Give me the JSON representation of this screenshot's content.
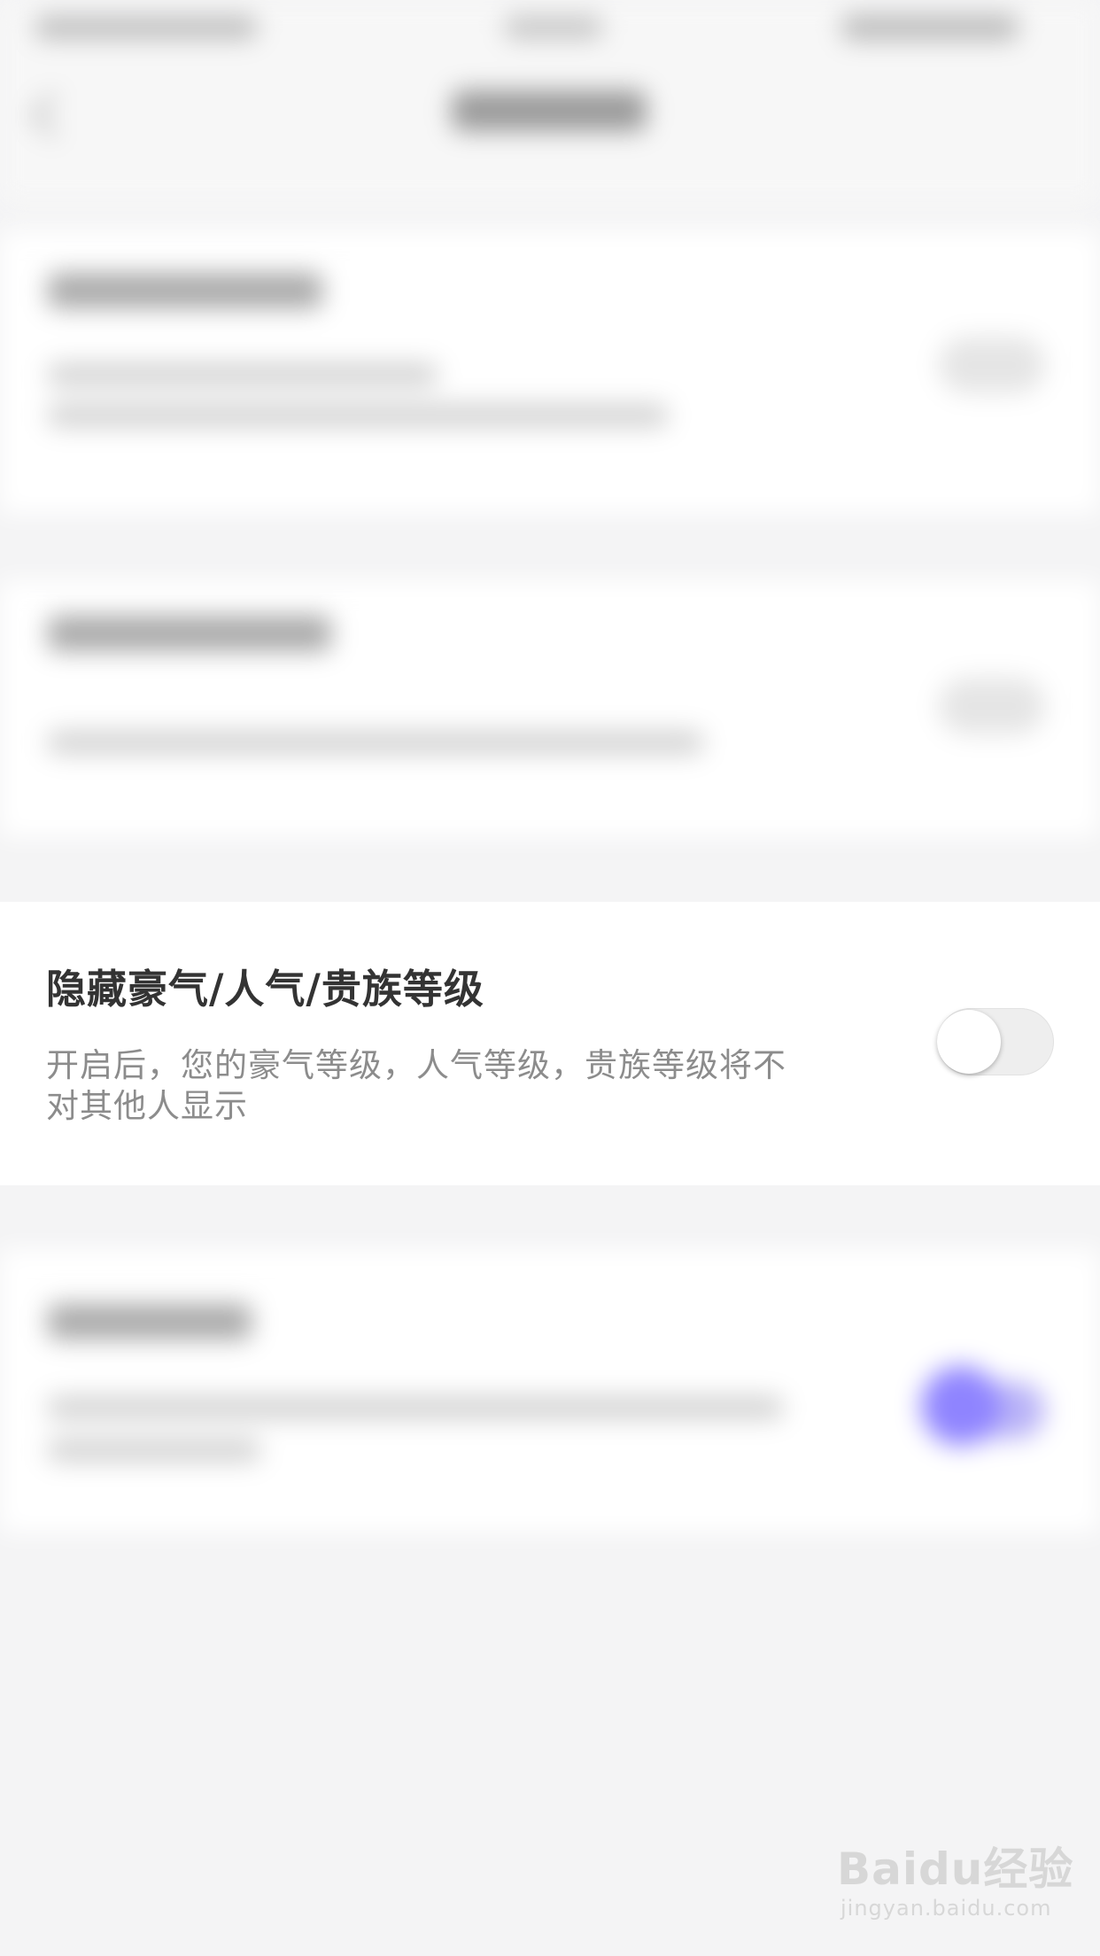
{
  "setting": {
    "title": "隐藏豪气/人气/贵族等级",
    "description": "开启后，您的豪气等级，人气等级，贵族等级将不对其他人显示",
    "toggle_state": "off"
  },
  "watermark": {
    "logo_text": "Baidu经验",
    "url_text": "jingyan.baidu.com"
  }
}
